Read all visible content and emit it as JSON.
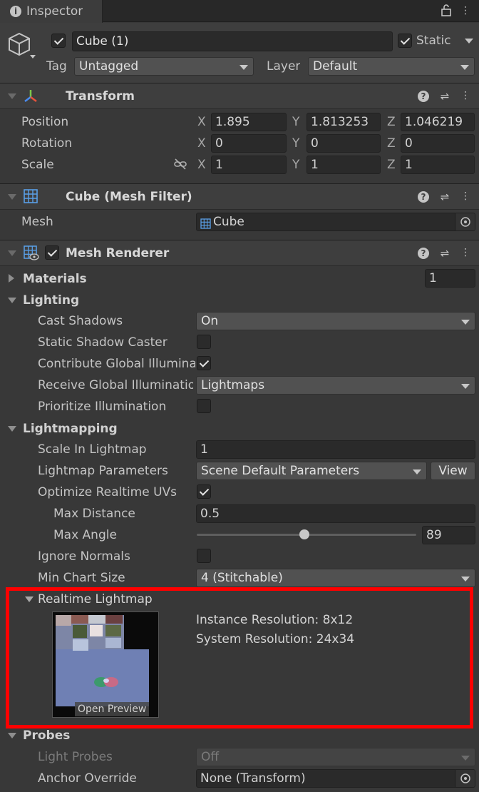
{
  "tab": {
    "title": "Inspector"
  },
  "object": {
    "name": "Cube (1)",
    "static_label": "Static",
    "tag_label": "Tag",
    "tag_value": "Untagged",
    "layer_label": "Layer",
    "layer_value": "Default"
  },
  "transform": {
    "title": "Transform",
    "position": {
      "label": "Position",
      "x": "1.895",
      "y": "1.813253",
      "z": "1.046219"
    },
    "rotation": {
      "label": "Rotation",
      "x": "0",
      "y": "0",
      "z": "0"
    },
    "scale": {
      "label": "Scale",
      "x": "1",
      "y": "1",
      "z": "1"
    },
    "axis": {
      "x": "X",
      "y": "Y",
      "z": "Z"
    }
  },
  "mesh_filter": {
    "title": "Cube (Mesh Filter)",
    "mesh_label": "Mesh",
    "mesh_value": "Cube"
  },
  "mesh_renderer": {
    "title": "Mesh Renderer",
    "materials": {
      "label": "Materials",
      "count": "1"
    },
    "lighting": {
      "label": "Lighting",
      "cast_shadows": {
        "label": "Cast Shadows",
        "value": "On"
      },
      "static_shadow_caster": {
        "label": "Static Shadow Caster"
      },
      "contribute_gi": {
        "label": "Contribute Global Illumination"
      },
      "receive_gi": {
        "label": "Receive Global Illumination",
        "value": "Lightmaps"
      },
      "prioritize": {
        "label": "Prioritize Illumination"
      }
    },
    "lightmapping": {
      "label": "Lightmapping",
      "scale": {
        "label": "Scale In Lightmap",
        "value": "1"
      },
      "params": {
        "label": "Lightmap Parameters",
        "value": "Scene Default Parameters",
        "view": "View"
      },
      "optimize": {
        "label": "Optimize Realtime UVs"
      },
      "max_distance": {
        "label": "Max Distance",
        "value": "0.5"
      },
      "max_angle": {
        "label": "Max Angle",
        "value": "89",
        "fraction": 0.49
      },
      "ignore_normals": {
        "label": "Ignore Normals"
      },
      "min_chart": {
        "label": "Min Chart Size",
        "value": "4 (Stitchable)"
      }
    },
    "realtime_lightmap": {
      "label": "Realtime Lightmap",
      "open_preview": "Open Preview",
      "instance_resolution": "Instance Resolution: 8x12",
      "system_resolution": "System Resolution: 24x34"
    },
    "probes": {
      "label": "Probes",
      "light_probes": {
        "label": "Light Probes",
        "value": "Off"
      },
      "anchor_override": {
        "label": "Anchor Override",
        "value": "None (Transform)"
      }
    }
  },
  "colors": {
    "highlight": "#ff0000",
    "background": "#383838"
  }
}
